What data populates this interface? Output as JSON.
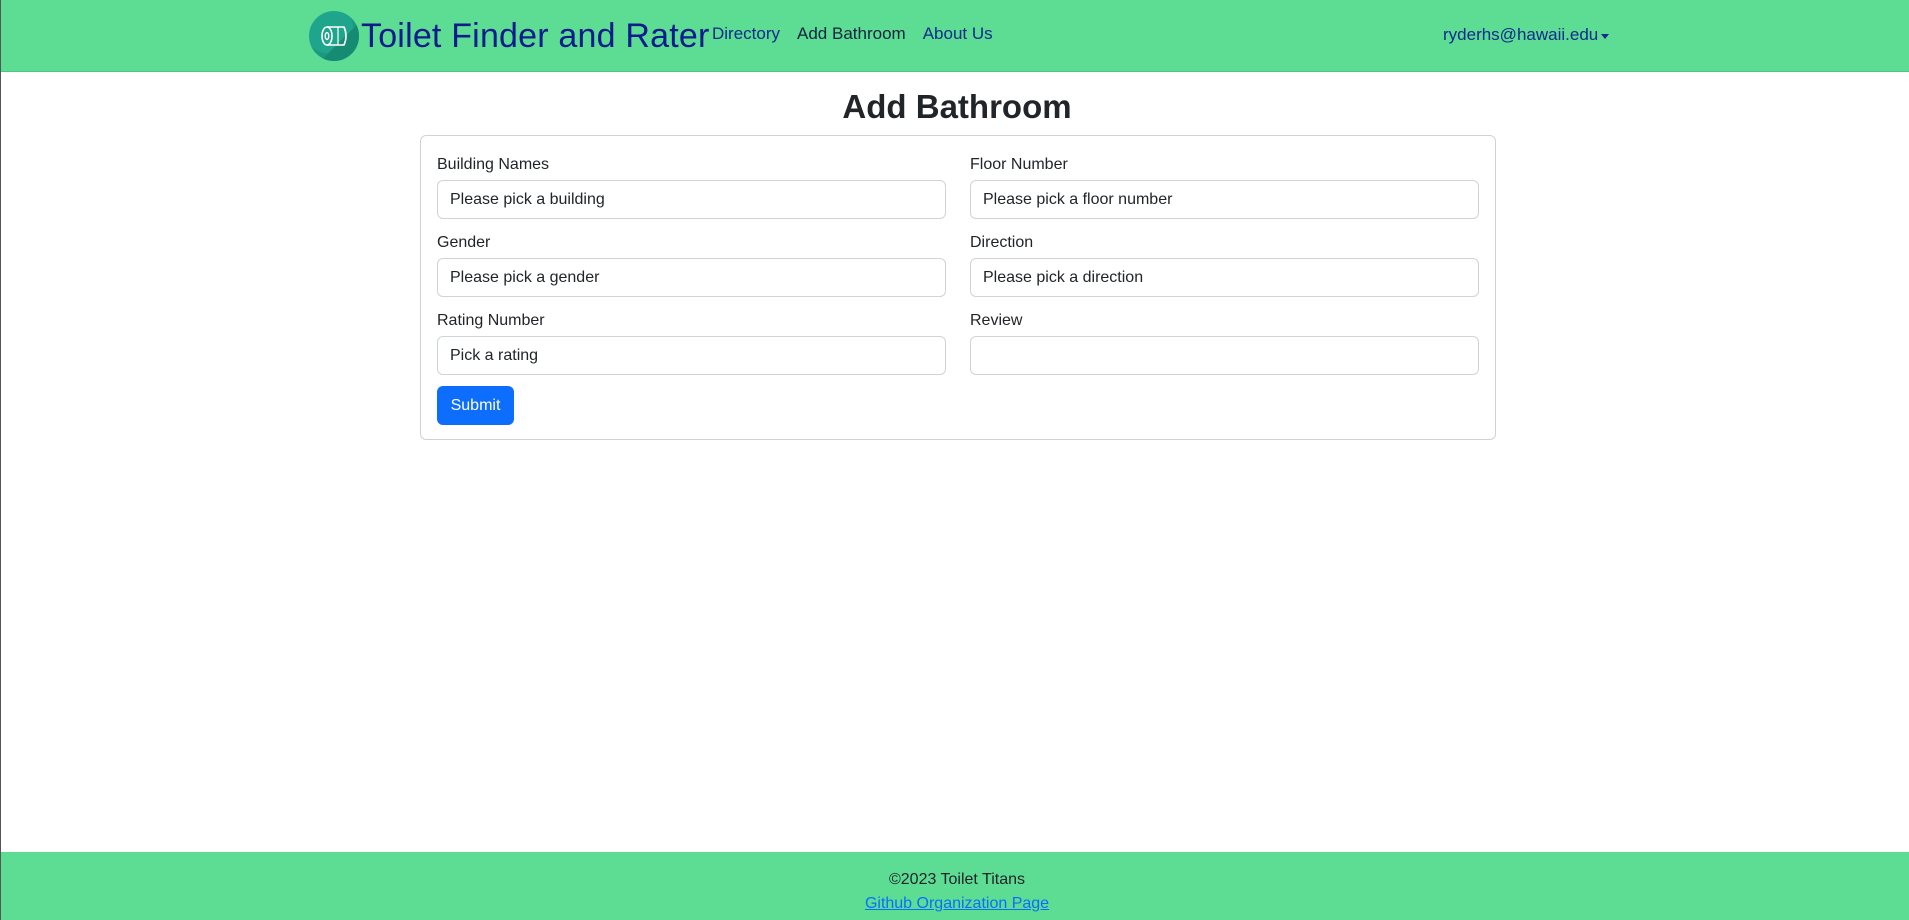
{
  "navbar": {
    "brand": "Toilet Finder and Rater",
    "links": [
      "Directory",
      "Add Bathroom",
      "About Us"
    ],
    "user": "ryderhs@hawaii.edu"
  },
  "page": {
    "title": "Add Bathroom"
  },
  "form": {
    "building": {
      "label": "Building Names",
      "value": "Please pick a building"
    },
    "floor": {
      "label": "Floor Number",
      "value": "Please pick a floor number"
    },
    "gender": {
      "label": "Gender",
      "value": "Please pick a gender"
    },
    "direction": {
      "label": "Direction",
      "value": "Please pick a direction"
    },
    "rating": {
      "label": "Rating Number",
      "value": "Pick a rating"
    },
    "review": {
      "label": "Review",
      "value": ""
    },
    "submit_label": "Submit"
  },
  "footer": {
    "copyright": "©2023 Toilet Titans",
    "link_text": "Github Organization Page"
  },
  "colors": {
    "navbar_bg": "#5ddc93",
    "brand_text": "#0d1c8c",
    "primary": "#0d6efd"
  }
}
